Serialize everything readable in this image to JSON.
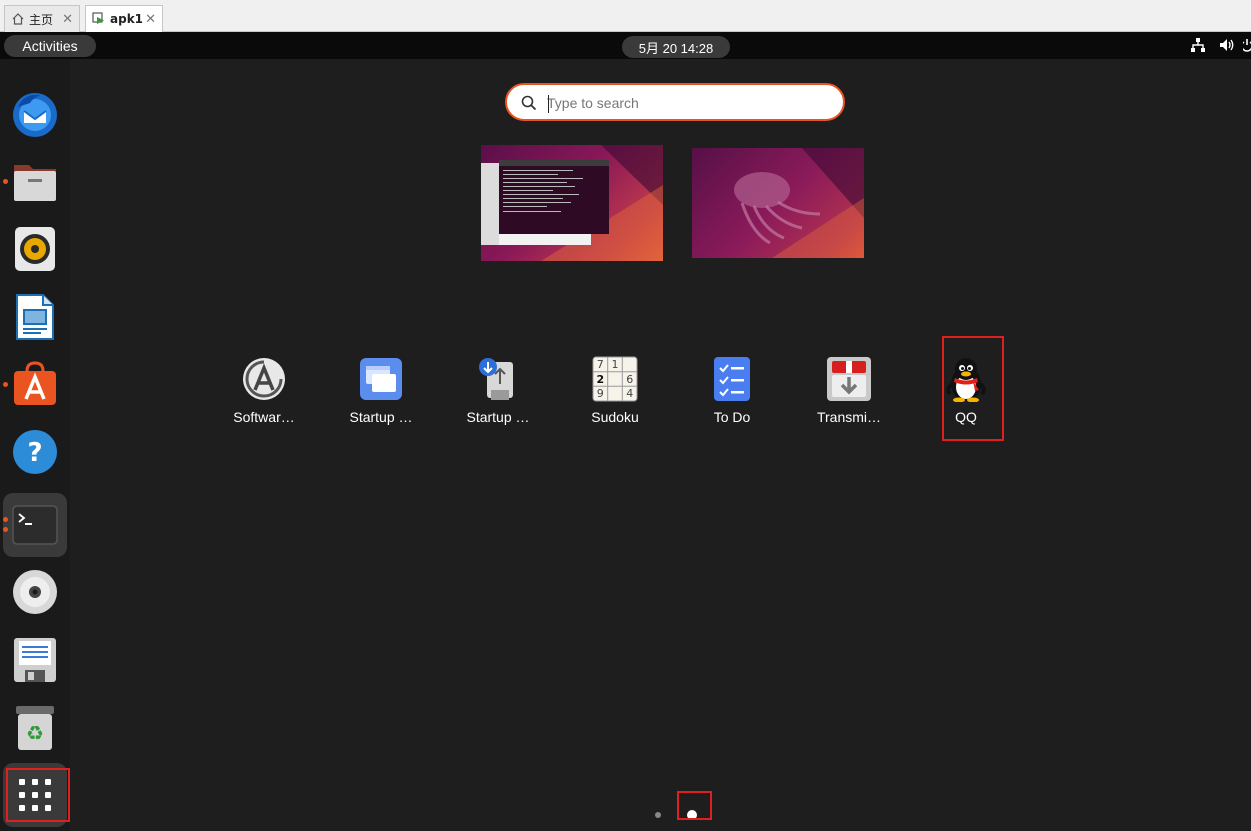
{
  "host_tabs": [
    {
      "label": "主页",
      "icon": "home-icon"
    },
    {
      "label": "apk1",
      "icon": "vm-icon"
    }
  ],
  "topbar": {
    "activities": "Activities",
    "clock": "5月 20  14:28",
    "tray_icons": [
      "network-icon",
      "volume-icon",
      "power-icon"
    ]
  },
  "dock": {
    "items": [
      {
        "name": "thunderbird",
        "running": false
      },
      {
        "name": "files",
        "running": true
      },
      {
        "name": "rhythmbox",
        "running": false
      },
      {
        "name": "libreoffice-writer",
        "running": false
      },
      {
        "name": "ubuntu-software",
        "running": true
      },
      {
        "name": "help",
        "running": false
      },
      {
        "name": "terminal",
        "running": true
      },
      {
        "name": "dvd-drive",
        "running": false
      },
      {
        "name": "floppy-drive",
        "running": false
      },
      {
        "name": "trash",
        "running": false
      },
      {
        "name": "show-applications",
        "running": false
      }
    ]
  },
  "search": {
    "placeholder": "Type to search"
  },
  "apps": [
    {
      "label": "Softwar…",
      "icon": "software-updater-icon"
    },
    {
      "label": "Startup …",
      "icon": "startup-applications-icon"
    },
    {
      "label": "Startup …",
      "icon": "startup-disk-creator-icon"
    },
    {
      "label": "Sudoku",
      "icon": "sudoku-icon",
      "digits": [
        "7",
        "1",
        "",
        "2",
        "",
        "6",
        "9",
        "",
        "4"
      ]
    },
    {
      "label": "To Do",
      "icon": "todo-icon"
    },
    {
      "label": "Transmi…",
      "icon": "transmission-icon"
    },
    {
      "label": "QQ",
      "icon": "qq-penguin-icon"
    }
  ],
  "pages": {
    "count": 2,
    "current": 2
  },
  "colors": {
    "accent": "#e95420",
    "highlight": "#e02020"
  }
}
